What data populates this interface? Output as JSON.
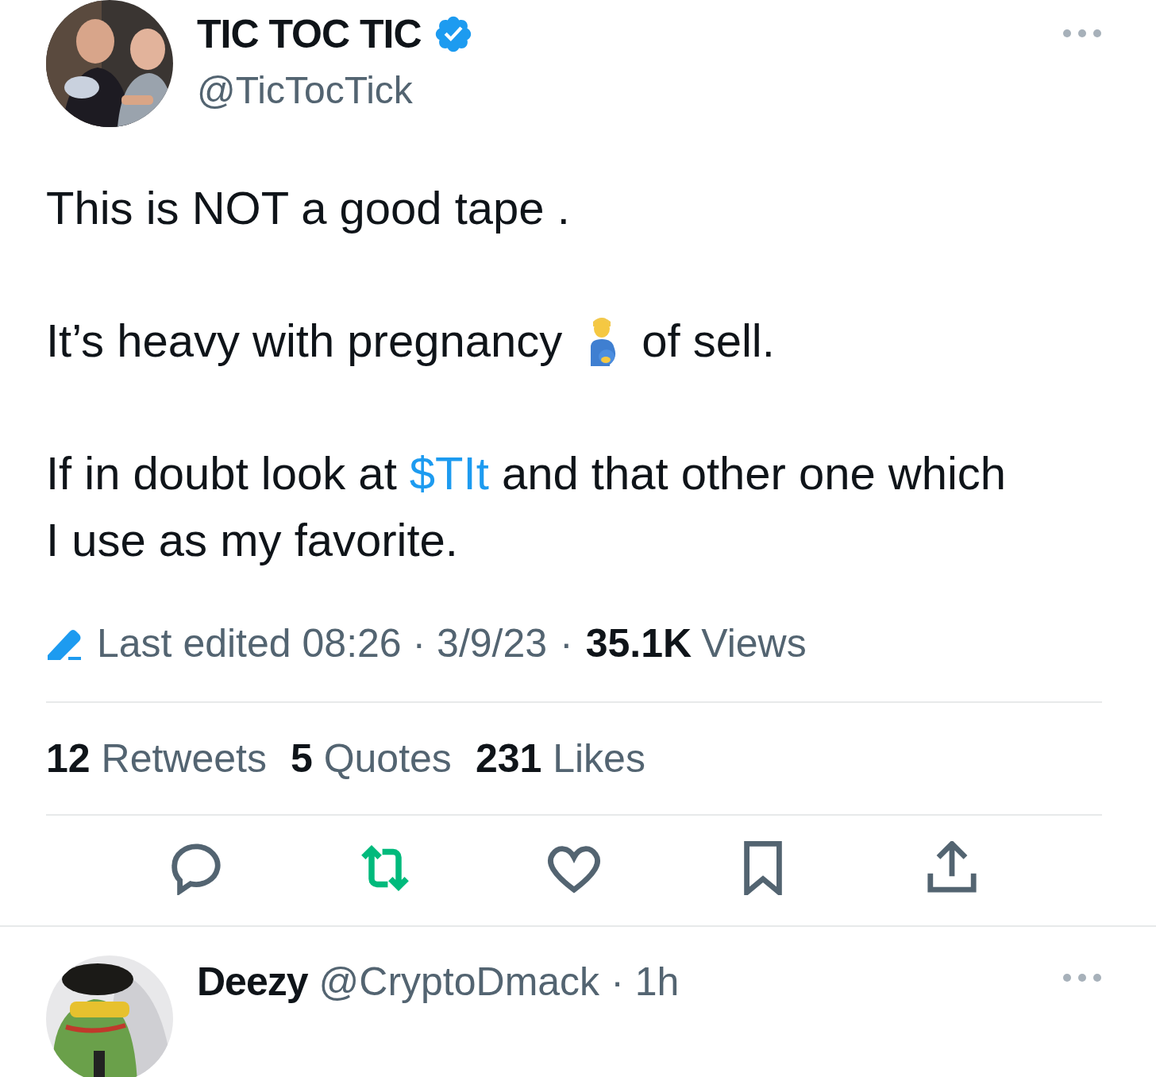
{
  "tweet": {
    "author": {
      "name": "TIC TOC TIC",
      "verified": true,
      "handle": "@TicTocTick"
    },
    "body": [
      {
        "kind": "text",
        "text": "This is NOT a good tape ."
      },
      {
        "kind": "emoji",
        "before": "It’s heavy with pregnancy",
        "after": "of sell."
      },
      {
        "kind": "link",
        "before": "If in doubt look at",
        "link": "$TIt",
        "after": "and that other one which I use as my favorite."
      }
    ],
    "meta": {
      "edited": "Last edited 08:26 · 3/9/23",
      "separator": "·",
      "views_count": "35.1K",
      "views_label": "Views"
    },
    "stats": [
      {
        "count": "12",
        "label": "Retweets"
      },
      {
        "count": "5",
        "label": "Quotes"
      },
      {
        "count": "231",
        "label": "Likes"
      }
    ],
    "actions": [
      {
        "kind": "reply"
      },
      {
        "kind": "retweet"
      },
      {
        "kind": "like"
      },
      {
        "kind": "bookmark"
      },
      {
        "kind": "share"
      }
    ]
  },
  "reply": {
    "name": "Deezy",
    "handle": "@CryptoDmack",
    "separator": "·",
    "time": "1h"
  }
}
